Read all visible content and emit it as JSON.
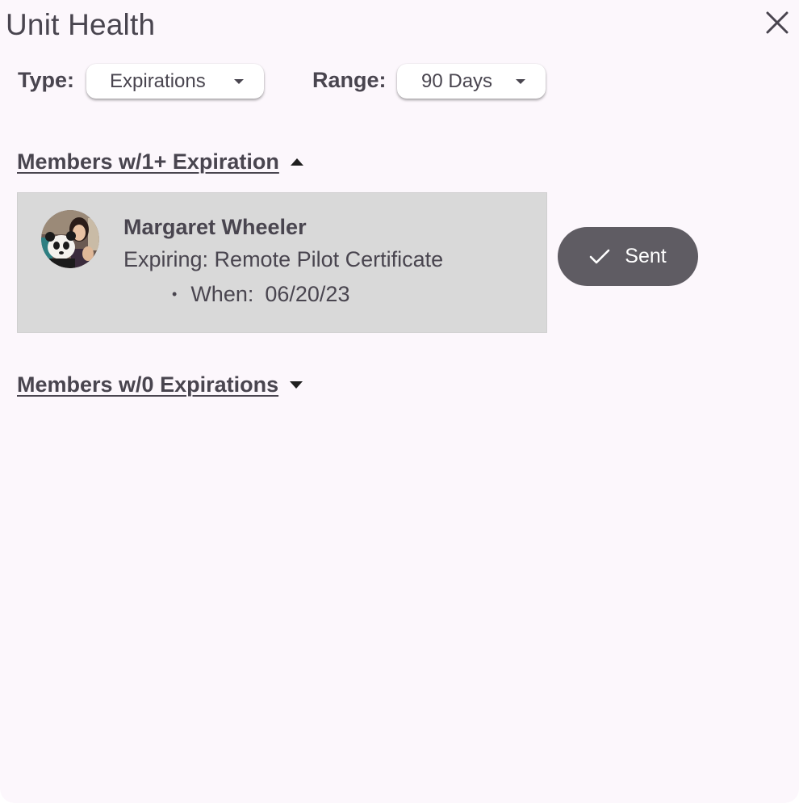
{
  "dialog": {
    "title": "Unit Health"
  },
  "filters": {
    "type_label": "Type:",
    "type_value": "Expirations",
    "range_label": "Range:",
    "range_value": "90 Days"
  },
  "sections": [
    {
      "label": "Members w/1+ Expiration",
      "expanded": true,
      "members": [
        {
          "name": "Margaret Wheeler",
          "expiring": "Expiring: Remote Pilot Certificate",
          "bullet": "•",
          "when_label": "When:",
          "when_value": "06/20/23",
          "action_label": "Sent"
        }
      ]
    },
    {
      "label": "Members w/0 Expirations",
      "expanded": false,
      "members": []
    }
  ],
  "icons": {
    "close": "close-icon",
    "type_caret": "caret-down-icon",
    "range_caret": "caret-down-icon",
    "section1_toggle": "triangle-up-icon",
    "section2_toggle": "triangle-down-icon",
    "sent_check": "check-icon"
  },
  "colors": {
    "background": "#fcf7fc",
    "text": "#49454f",
    "card": "#d9d9d9",
    "sent_button": "#5f5c63"
  }
}
